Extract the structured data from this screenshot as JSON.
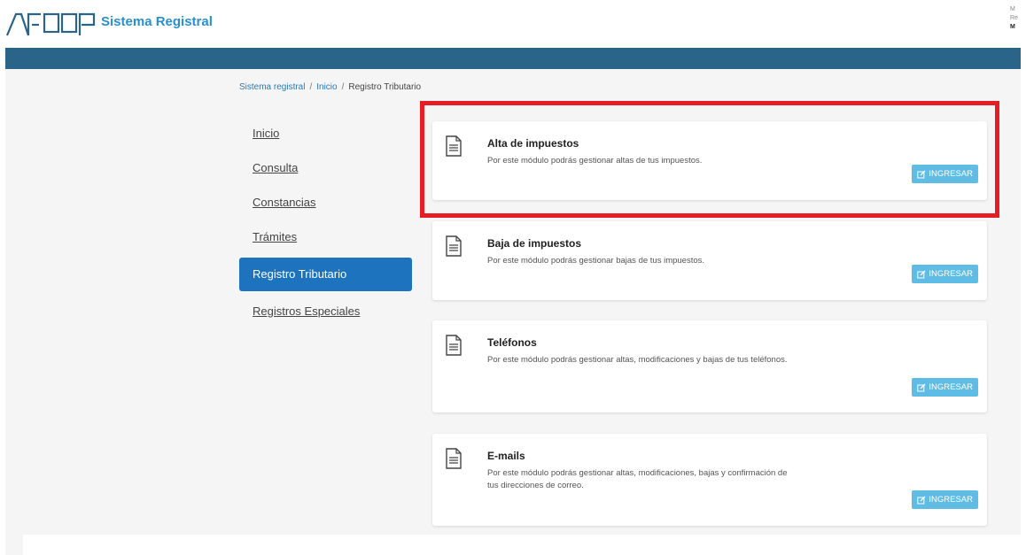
{
  "header": {
    "app_title": "Sistema Registral",
    "user_line1": "M",
    "user_line2": "Re",
    "user_name": "M"
  },
  "breadcrumb": {
    "items": [
      "Sistema registral",
      "Inicio"
    ],
    "current": "Registro Tributario",
    "separator": "/"
  },
  "sidebar": {
    "items": [
      {
        "label": "Inicio"
      },
      {
        "label": "Consulta"
      },
      {
        "label": "Constancias"
      },
      {
        "label": "Trámites"
      },
      {
        "label": "Registro Tributario",
        "active": true
      },
      {
        "label": "Registros Especiales"
      }
    ]
  },
  "cards": [
    {
      "title": "Alta de impuestos",
      "description": "Por este módulo podrás gestionar altas de tus impuestos.",
      "button": "INGRESAR",
      "icon": "document-icon"
    },
    {
      "title": "Baja de impuestos",
      "description": "Por este módulo podrás gestionar bajas de tus impuestos.",
      "button": "INGRESAR",
      "icon": "document-icon"
    },
    {
      "title": "Teléfonos",
      "description": "Por este módulo podrás gestionar altas, modificaciones y bajas de tus teléfonos.",
      "button": "INGRESAR",
      "icon": "document-icon"
    },
    {
      "title": "E-mails",
      "description": "Por este módulo podrás gestionar altas, modificaciones, bajas y confirmación de tus direcciones de correo.",
      "button": "INGRESAR",
      "icon": "document-icon"
    }
  ],
  "colors": {
    "brand_blue": "#2a8fd0",
    "header_bar": "#2a6488",
    "active_nav": "#1d73bd",
    "button": "#5fbde5",
    "highlight": "#e51e25"
  }
}
